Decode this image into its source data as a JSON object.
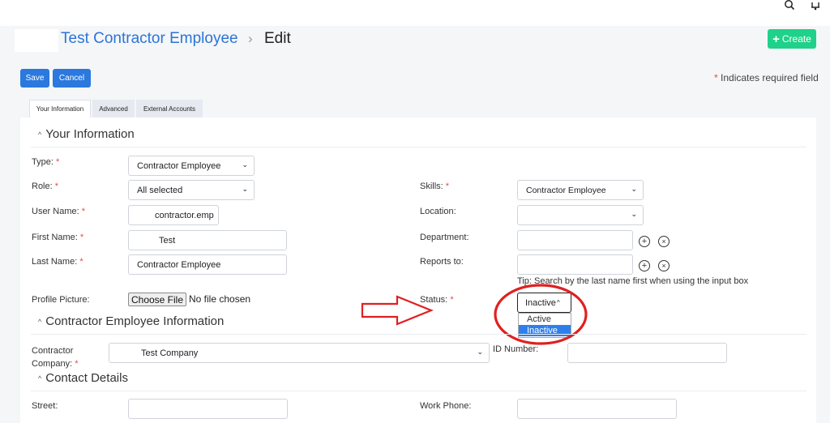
{
  "header": {
    "breadcrumb_parent": "Test Contractor Employee",
    "breadcrumb_separator": "›",
    "breadcrumb_current": "Edit",
    "create_label": "Create"
  },
  "toolbar": {
    "save_label": "Save",
    "cancel_label": "Cancel",
    "required_note": "Indicates required field",
    "required_star": "*"
  },
  "tabs": [
    {
      "label": "Your Information",
      "active": true
    },
    {
      "label": "Advanced",
      "active": false
    },
    {
      "label": "External Accounts",
      "active": false
    }
  ],
  "sections": {
    "your_info": "Your Information",
    "contractor_info": "Contractor Employee Information",
    "contact": "Contact Details"
  },
  "fields": {
    "type": {
      "label": "Type:",
      "value": "Contractor Employee"
    },
    "role": {
      "label": "Role:",
      "value": "All selected"
    },
    "user_name": {
      "label": "User Name:",
      "value": "contractor.emp"
    },
    "first_name": {
      "label": "First Name:",
      "value": "Test"
    },
    "last_name": {
      "label": "Last Name:",
      "value": "Contractor Employee"
    },
    "profile_picture": {
      "label": "Profile Picture:",
      "button": "Choose File",
      "status": "No file chosen"
    },
    "skills": {
      "label": "Skills:",
      "value": "Contractor Employee"
    },
    "location": {
      "label": "Location:",
      "value": ""
    },
    "department": {
      "label": "Department:",
      "value": ""
    },
    "reports_to": {
      "label": "Reports to:",
      "value": "",
      "tip": "Tip: Search by the last name first when using the input box"
    },
    "status": {
      "label": "Status:",
      "value": "Inactive",
      "options": [
        "Active",
        "Inactive"
      ],
      "selected_option": "Inactive"
    },
    "contractor_company": {
      "label_line1": "Contractor",
      "label_line2": "Company:",
      "value": "Test Company"
    },
    "id_number": {
      "label": "ID Number:",
      "value": ""
    },
    "street": {
      "label": "Street:",
      "value": ""
    },
    "work_phone": {
      "label": "Work Phone:",
      "value": ""
    }
  },
  "icons": {
    "search": "search-icon",
    "bell": "bell-icon",
    "add": "add-circle-icon",
    "clear": "clear-circle-icon",
    "chevron": "chevron-down-icon"
  },
  "colors": {
    "primary": "#2b78de",
    "link": "#2b74d8",
    "create": "#1fd18a",
    "required": "#e34b4b",
    "annotation": "#e02020",
    "option_selected": "#2f7fea"
  }
}
